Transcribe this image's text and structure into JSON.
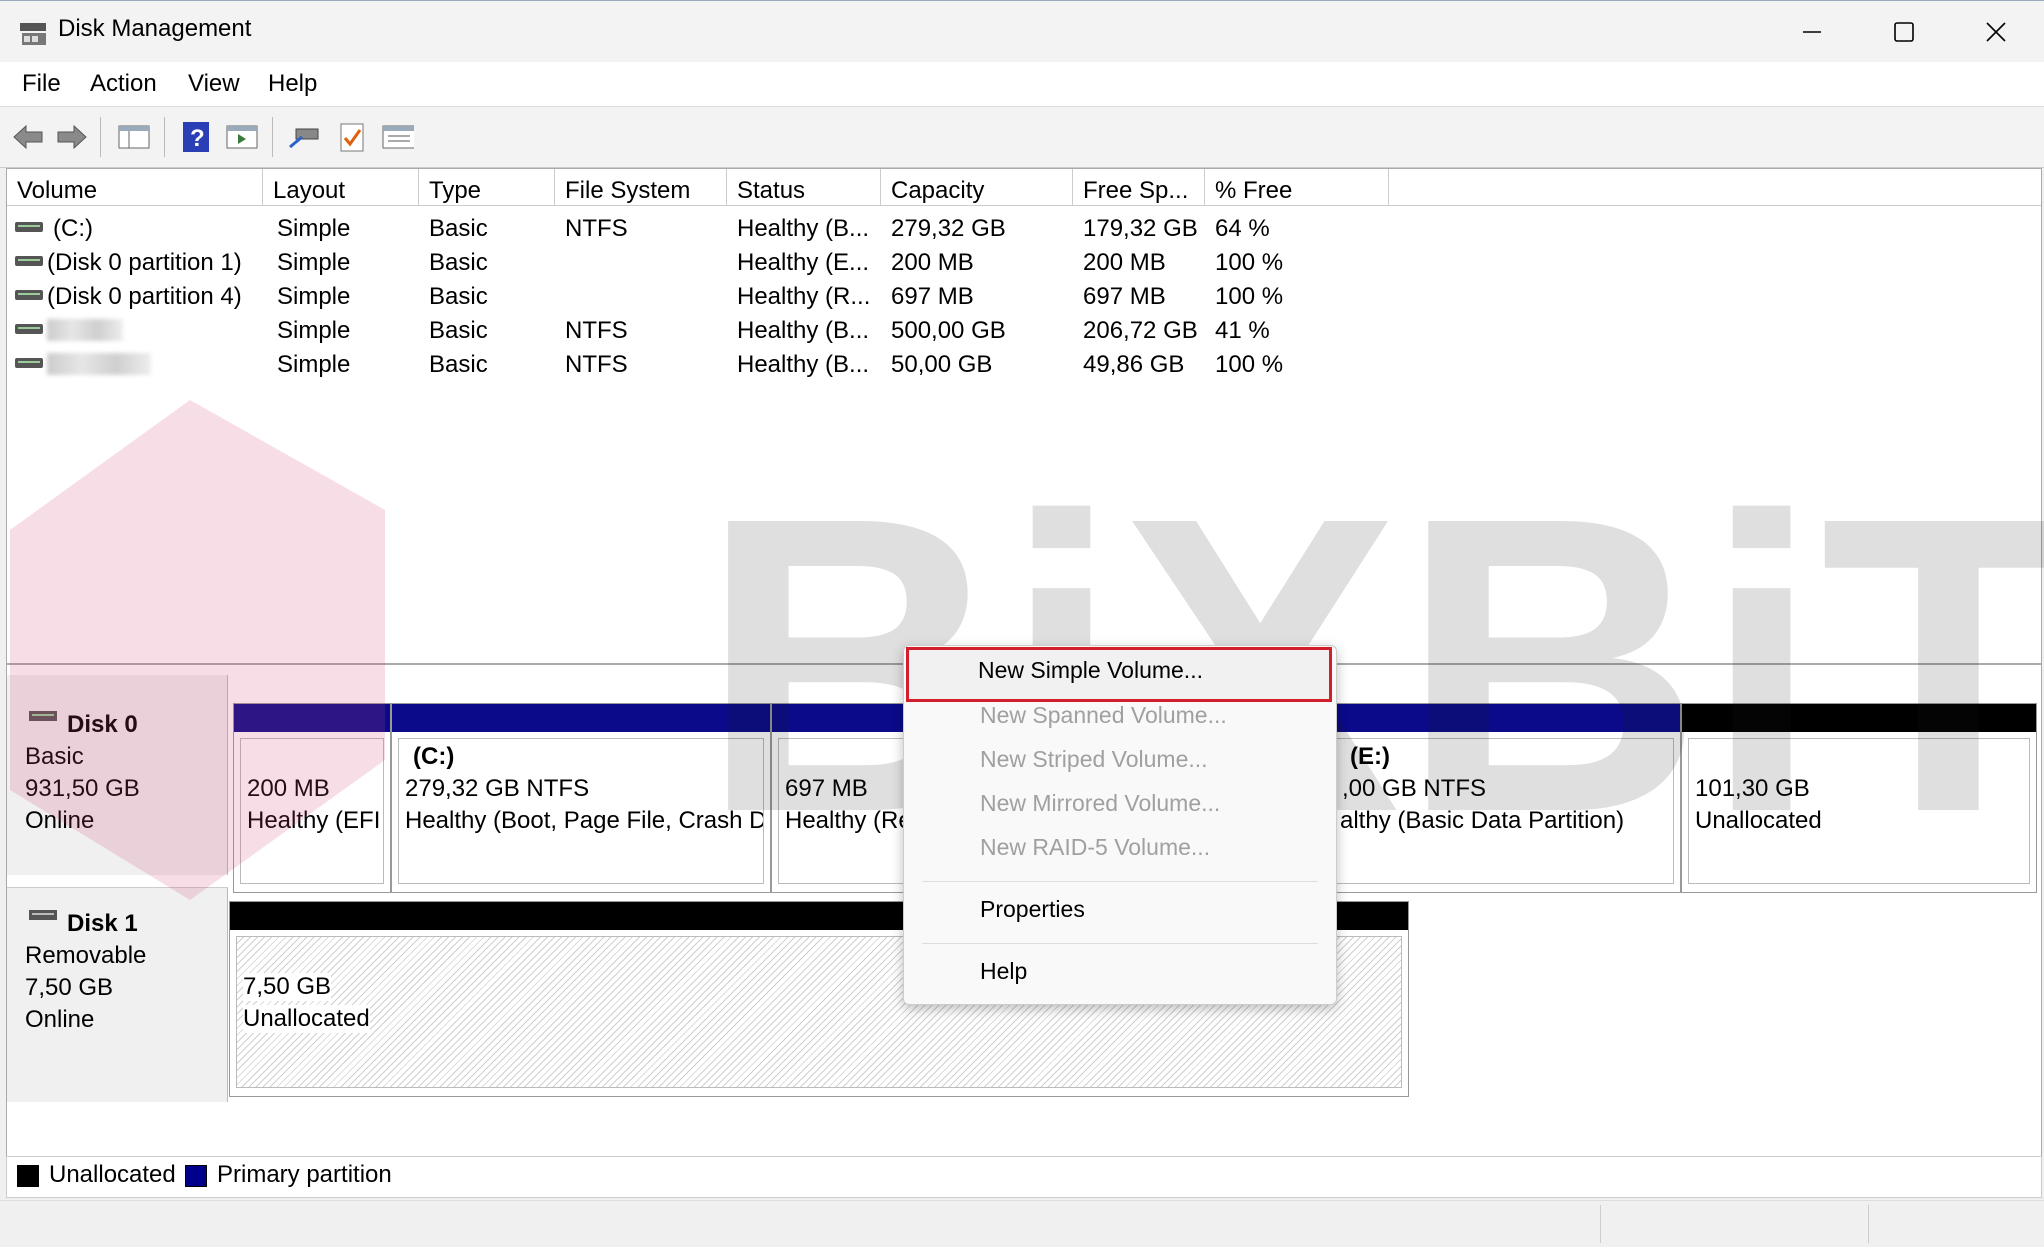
{
  "window": {
    "title": "Disk Management",
    "icon": "disk-management-icon"
  },
  "menu": [
    "File",
    "Action",
    "View",
    "Help"
  ],
  "toolbar": {
    "icons": [
      "back-arrow-icon",
      "forward-arrow-icon",
      "console-tree-icon",
      "help-icon",
      "action-pane-icon",
      "connect-icon",
      "checklist-icon",
      "properties-list-icon"
    ]
  },
  "volume_list": {
    "columns": [
      "Volume",
      "Layout",
      "Type",
      "File System",
      "Status",
      "Capacity",
      "Free Sp...",
      "% Free"
    ],
    "rows": [
      {
        "volume": "(C:)",
        "layout": "Simple",
        "type": "Basic",
        "fs": "NTFS",
        "status": "Healthy (B...",
        "capacity": "279,32 GB",
        "free": "179,32 GB",
        "pct": "64 %"
      },
      {
        "volume": "(Disk 0 partition 1)",
        "layout": "Simple",
        "type": "Basic",
        "fs": "",
        "status": "Healthy (E...",
        "capacity": "200 MB",
        "free": "200 MB",
        "pct": "100 %"
      },
      {
        "volume": "(Disk 0 partition 4)",
        "layout": "Simple",
        "type": "Basic",
        "fs": "",
        "status": "Healthy (R...",
        "capacity": "697 MB",
        "free": "697 MB",
        "pct": "100 %"
      },
      {
        "volume": "",
        "layout": "Simple",
        "type": "Basic",
        "fs": "NTFS",
        "status": "Healthy (B...",
        "capacity": "500,00 GB",
        "free": "206,72 GB",
        "pct": "41 %"
      },
      {
        "volume": "",
        "layout": "Simple",
        "type": "Basic",
        "fs": "NTFS",
        "status": "Healthy (B...",
        "capacity": "50,00 GB",
        "free": "49,86 GB",
        "pct": "100 %"
      }
    ]
  },
  "disks": {
    "disk0": {
      "name": "Disk 0",
      "kind": "Basic",
      "size": "931,50 GB",
      "state": "Online",
      "partitions": [
        {
          "title": "",
          "line1": "200 MB",
          "line2": "Healthy (EFI"
        },
        {
          "title": "(C:)",
          "line1": "279,32 GB NTFS",
          "line2": "Healthy (Boot, Page File, Crash D"
        },
        {
          "title": "",
          "line1": "697 MB",
          "line2": "Healthy (Re"
        },
        {
          "title": "(E:)",
          "line1": ",00 GB NTFS",
          "line2": "althy (Basic Data Partition)"
        },
        {
          "title": "",
          "line1": "101,30 GB",
          "line2": "Unallocated"
        }
      ]
    },
    "disk1": {
      "name": "Disk 1",
      "kind": "Removable",
      "size": "7,50 GB",
      "state": "Online",
      "partitions": [
        {
          "line1": "7,50 GB",
          "line2": "Unallocated"
        }
      ]
    }
  },
  "legend": {
    "unallocated": "Unallocated",
    "primary": "Primary partition",
    "colors": {
      "unallocated": "#000000",
      "primary": "#00008b"
    }
  },
  "context_menu": {
    "items": [
      {
        "label": "New Simple Volume...",
        "enabled": true,
        "highlighted": true
      },
      {
        "label": "New Spanned Volume...",
        "enabled": false
      },
      {
        "label": "New Striped Volume...",
        "enabled": false
      },
      {
        "label": "New Mirrored Volume...",
        "enabled": false
      },
      {
        "label": "New RAID-5 Volume...",
        "enabled": false
      },
      {
        "label": "Properties",
        "enabled": true
      },
      {
        "label": "Help",
        "enabled": true
      }
    ]
  },
  "colors": {
    "primary_bar": "#0a0a8a",
    "unallocated_bar": "#000000",
    "highlight_border": "#d21f2b"
  }
}
